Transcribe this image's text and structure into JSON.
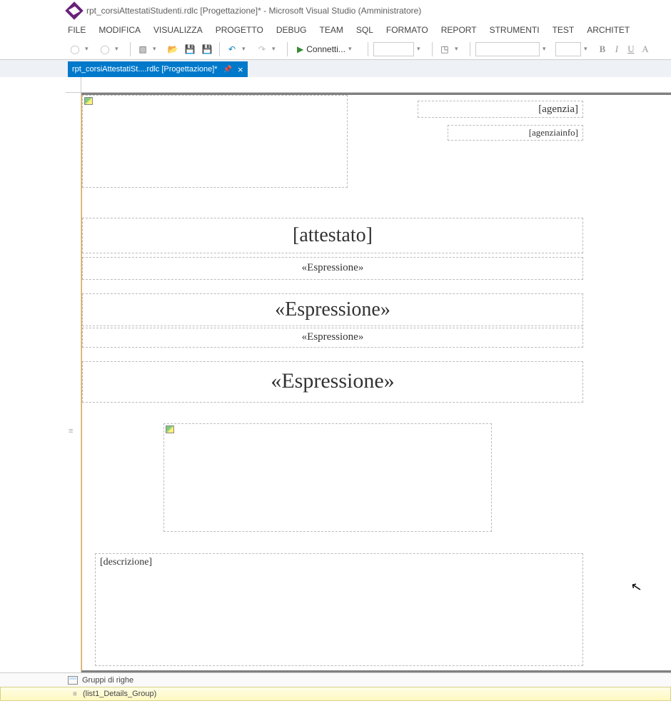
{
  "title": "rpt_corsiAttestatiStudenti.rdlc [Progettazione]* - Microsoft Visual Studio (Amministratore)",
  "menu": {
    "file": "FILE",
    "modifica": "MODIFICA",
    "visualizza": "VISUALIZZA",
    "progetto": "PROGETTO",
    "debug": "DEBUG",
    "team": "TEAM",
    "sql": "SQL",
    "formato": "FORMATO",
    "report": "REPORT",
    "strumenti": "STRUMENTI",
    "test": "TEST",
    "architet": "ARCHITET"
  },
  "toolbar": {
    "connect": "Connetti..."
  },
  "font_buttons": {
    "b": "B",
    "i": "I",
    "u": "U",
    "a": "A"
  },
  "tab": {
    "label": "rpt_corsiAttestatiSt....rdlc [Progettazione]*"
  },
  "report": {
    "agenzia": "[agenzia]",
    "agenziainfo": "[agenziainfo]",
    "attestato": "[attestato]",
    "espr1": "«Espressione»",
    "espr2": "«Espressione»",
    "espr3": "«Espressione»",
    "espr4": "«Espressione»",
    "descrizione": "[descrizione]"
  },
  "groups": {
    "header": "Gruppi di righe",
    "item": "(list1_Details_Group)"
  }
}
